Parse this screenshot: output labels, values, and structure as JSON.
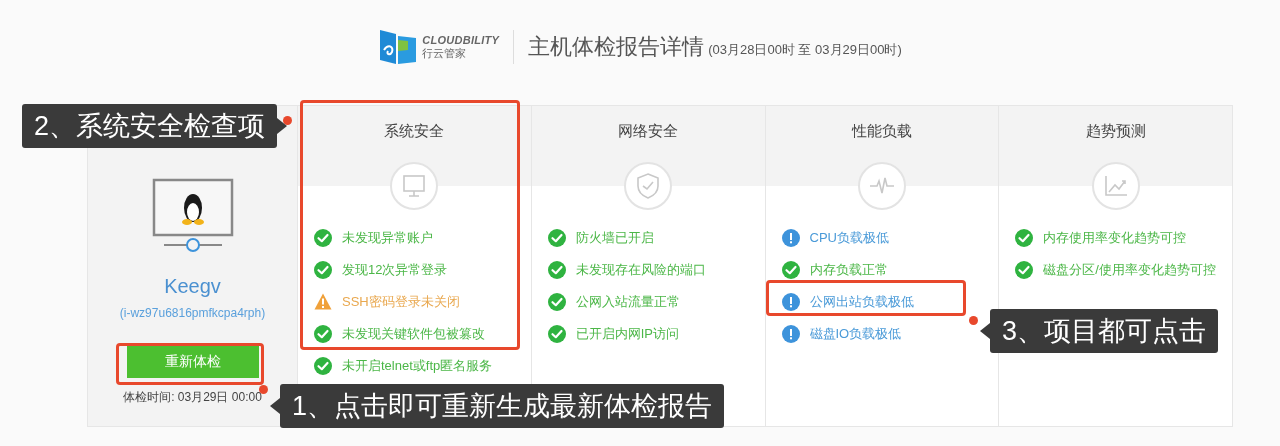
{
  "header": {
    "brand": "CLOUDBILITY",
    "brand_sub": "行云管家",
    "title": "主机体检报告详情",
    "range": "(03月28日00时 至 03月29日00时)"
  },
  "host": {
    "name": "Keegv",
    "id": "(i-wz97u6816pmfkcpa4rph)",
    "button": "重新体检",
    "check_time": "体检时间: 03月29日 00:00"
  },
  "categories": [
    {
      "title": "系统安全",
      "kind": "monitor",
      "items": [
        {
          "kind": "ok",
          "text": "未发现异常账户"
        },
        {
          "kind": "ok",
          "text": "发现12次异常登录"
        },
        {
          "kind": "warn",
          "text": "SSH密码登录未关闭"
        },
        {
          "kind": "ok",
          "text": "未发现关键软件包被篡改"
        },
        {
          "kind": "ok",
          "text": "未开启telnet或ftp匿名服务"
        }
      ]
    },
    {
      "title": "网络安全",
      "kind": "shield",
      "items": [
        {
          "kind": "ok",
          "text": "防火墙已开启"
        },
        {
          "kind": "ok",
          "text": "未发现存在风险的端口"
        },
        {
          "kind": "ok",
          "text": "公网入站流量正常"
        },
        {
          "kind": "ok",
          "text": "已开启内网IP访问"
        }
      ]
    },
    {
      "title": "性能负载",
      "kind": "pulse",
      "items": [
        {
          "kind": "info",
          "text": "CPU负载极低"
        },
        {
          "kind": "ok",
          "text": "内存负载正常"
        },
        {
          "kind": "info",
          "text": "公网出站负载极低"
        },
        {
          "kind": "info",
          "text": "磁盘IO负载极低"
        }
      ]
    },
    {
      "title": "趋势预测",
      "kind": "chart",
      "items": [
        {
          "kind": "ok",
          "text": "内存使用率变化趋势可控"
        },
        {
          "kind": "ok",
          "text": "磁盘分区/使用率变化趋势可控"
        }
      ]
    }
  ],
  "annotations": [
    {
      "text": "1、点击即可重新生成最新体检报告"
    },
    {
      "text": "2、系统安全检查项"
    },
    {
      "text": "3、项目都可点击"
    }
  ]
}
